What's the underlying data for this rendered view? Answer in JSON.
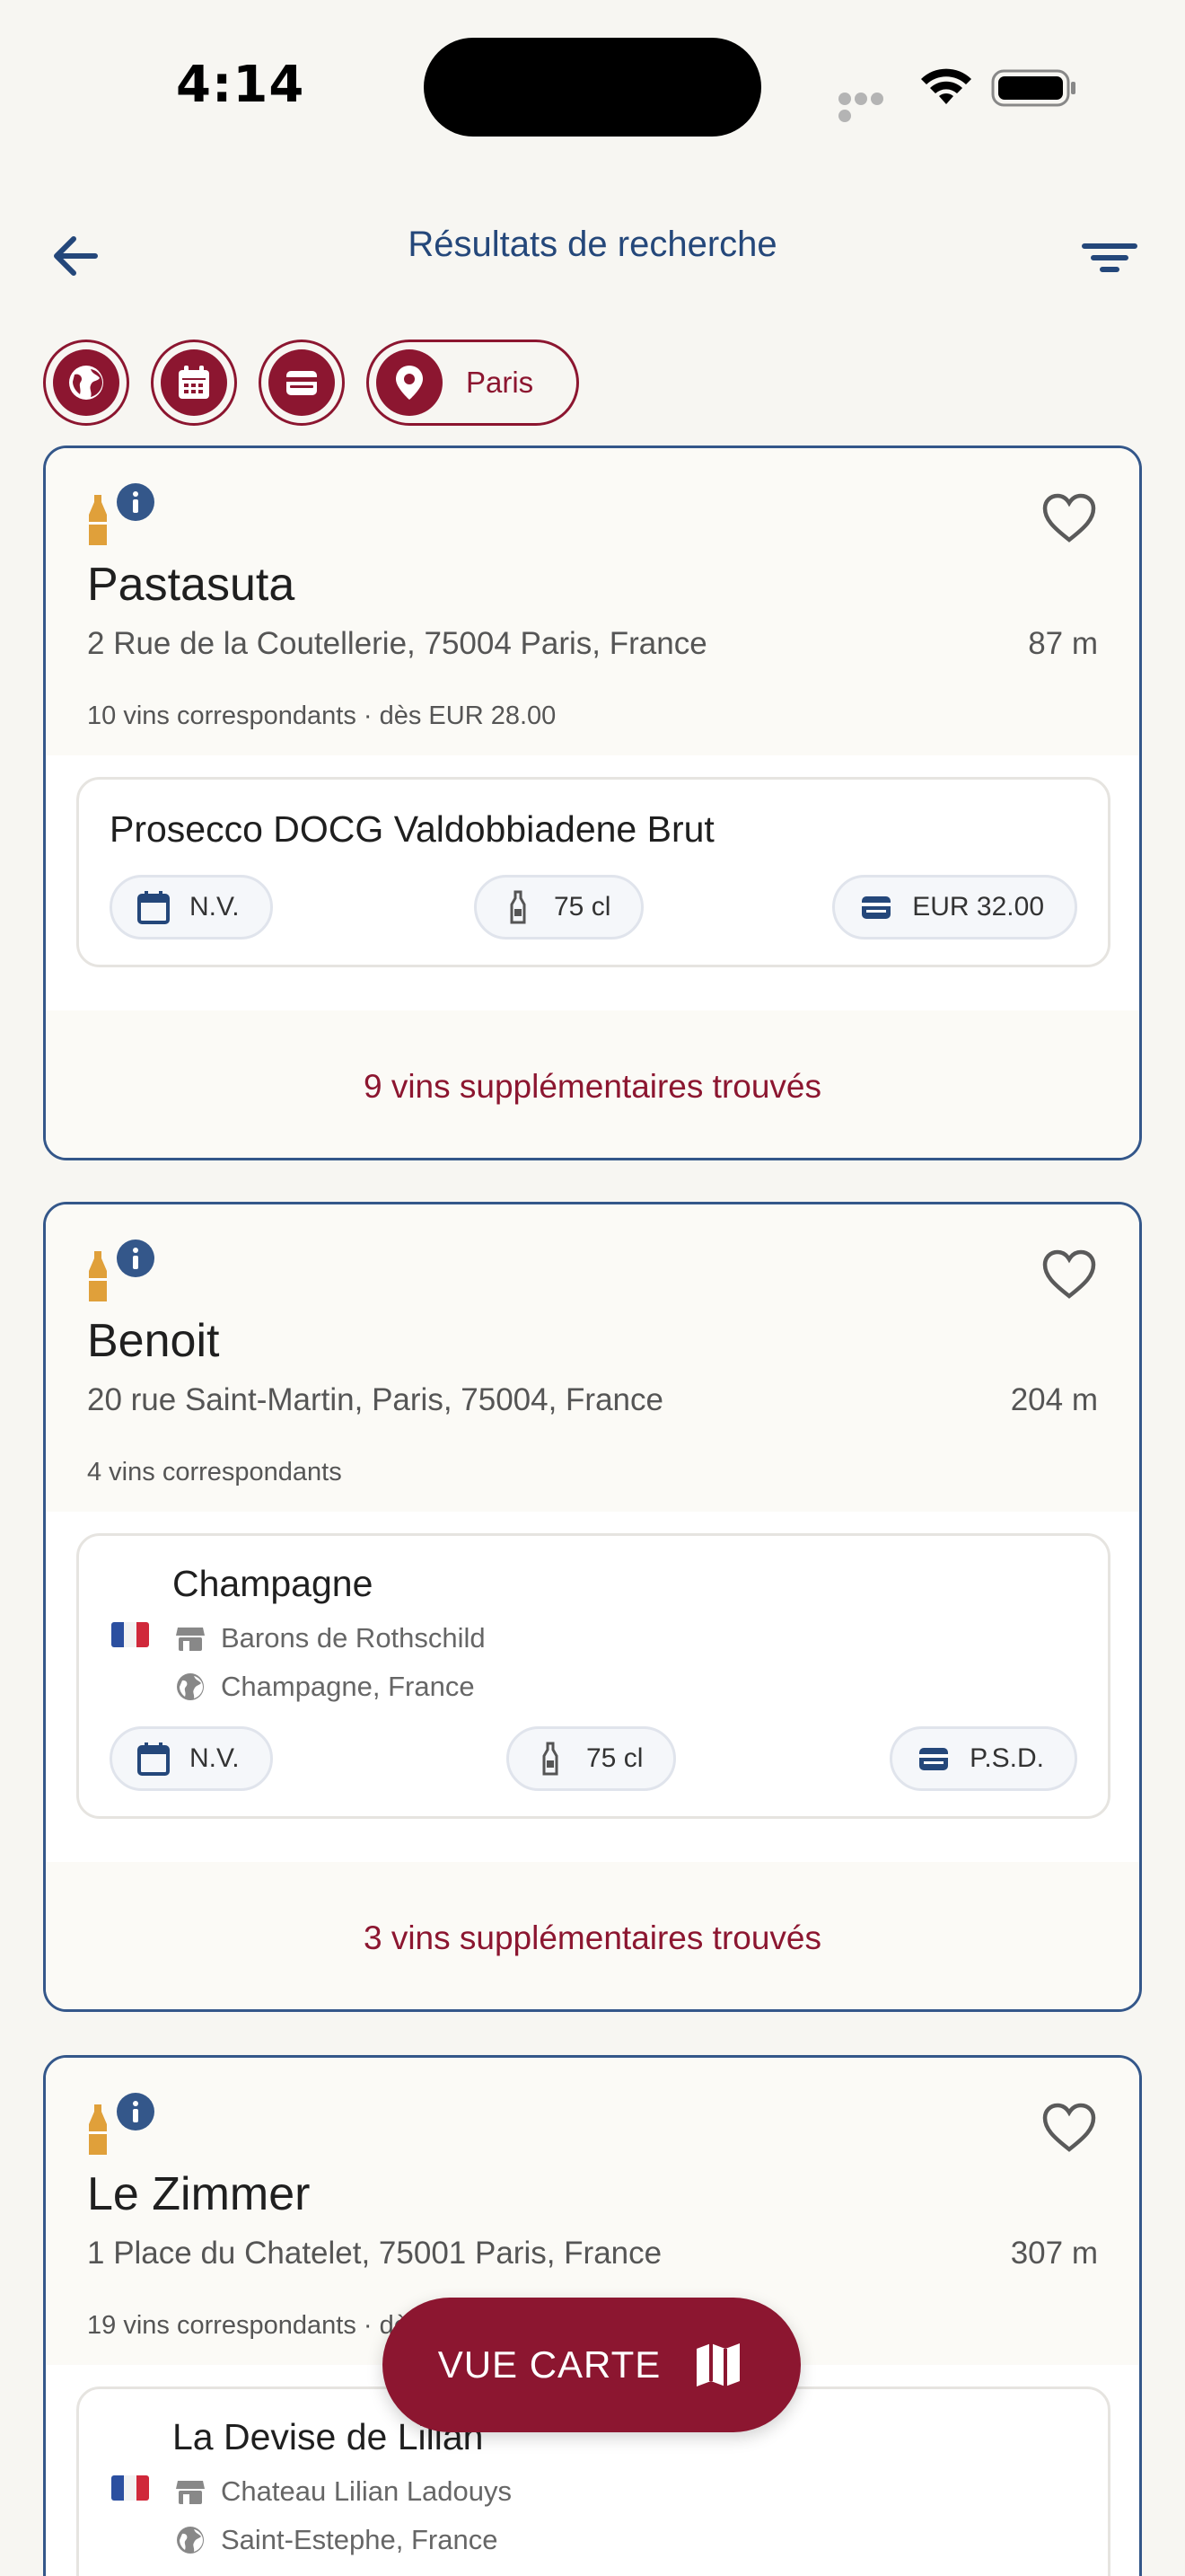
{
  "status": {
    "time": "4:14"
  },
  "header": {
    "title": "Résultats de recherche"
  },
  "filters": [
    {
      "icon": "globe-icon"
    },
    {
      "icon": "calendar-icon"
    },
    {
      "icon": "wallet-icon"
    },
    {
      "icon": "location-pin-icon",
      "label": "Paris"
    }
  ],
  "results": [
    {
      "name": "Pastasuta",
      "address": "2 Rue de la Coutellerie, 75004 Paris, France",
      "distance": "87 m",
      "count": "10 vins correspondants · dès EUR 28.00",
      "wine": {
        "name": "Prosecco DOCG Valdobbiadene Brut",
        "vintage": "N.V.",
        "volume": "75 cl",
        "price": "EUR 32.00"
      },
      "more": "9 vins supplémentaires trouvés"
    },
    {
      "name": "Benoit",
      "address": "20 rue Saint-Martin, Paris, 75004, France",
      "distance": "204 m",
      "count": "4 vins correspondants",
      "wine": {
        "name": "Champagne",
        "producer": "Barons de Rothschild",
        "region": "Champagne, France",
        "vintage": "N.V.",
        "volume": "75 cl",
        "price": "P.S.D."
      },
      "more": "3 vins supplémentaires trouvés"
    },
    {
      "name": "Le Zimmer",
      "address": "1 Place du Chatelet, 75001 Paris, France",
      "distance": "307 m",
      "count": "19 vins correspondants · dès EUR 35.00",
      "wine": {
        "name": "La Devise de Lilian",
        "producer": "Chateau Lilian Ladouys",
        "region": "Saint-Estephe, France"
      }
    }
  ],
  "map_button": {
    "label": "VUE CARTE"
  },
  "colors": {
    "brand": "#8c1630",
    "navy": "#24477a",
    "bottle": "#e0a03a",
    "background": "#f7f6f2"
  }
}
